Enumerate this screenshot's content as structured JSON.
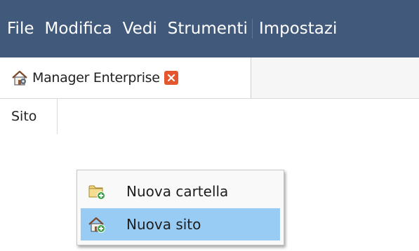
{
  "menubar": {
    "items": [
      "File",
      "Modifica",
      "Vedi",
      "Strumenti",
      "Impostazi"
    ],
    "background": "#41597a"
  },
  "tab": {
    "label": "Manager Enterprise",
    "icon": "house-gear-icon",
    "close_icon": "close-icon",
    "close_color": "#e4572e"
  },
  "toolbar": {
    "site_label": "Sito"
  },
  "context_menu": {
    "items": [
      {
        "label": "Nuova cartella",
        "icon": "folder-add-icon",
        "highlighted": false
      },
      {
        "label": "Nuova sito",
        "icon": "house-add-icon",
        "highlighted": true
      }
    ],
    "highlight_color": "#99ccf5"
  }
}
